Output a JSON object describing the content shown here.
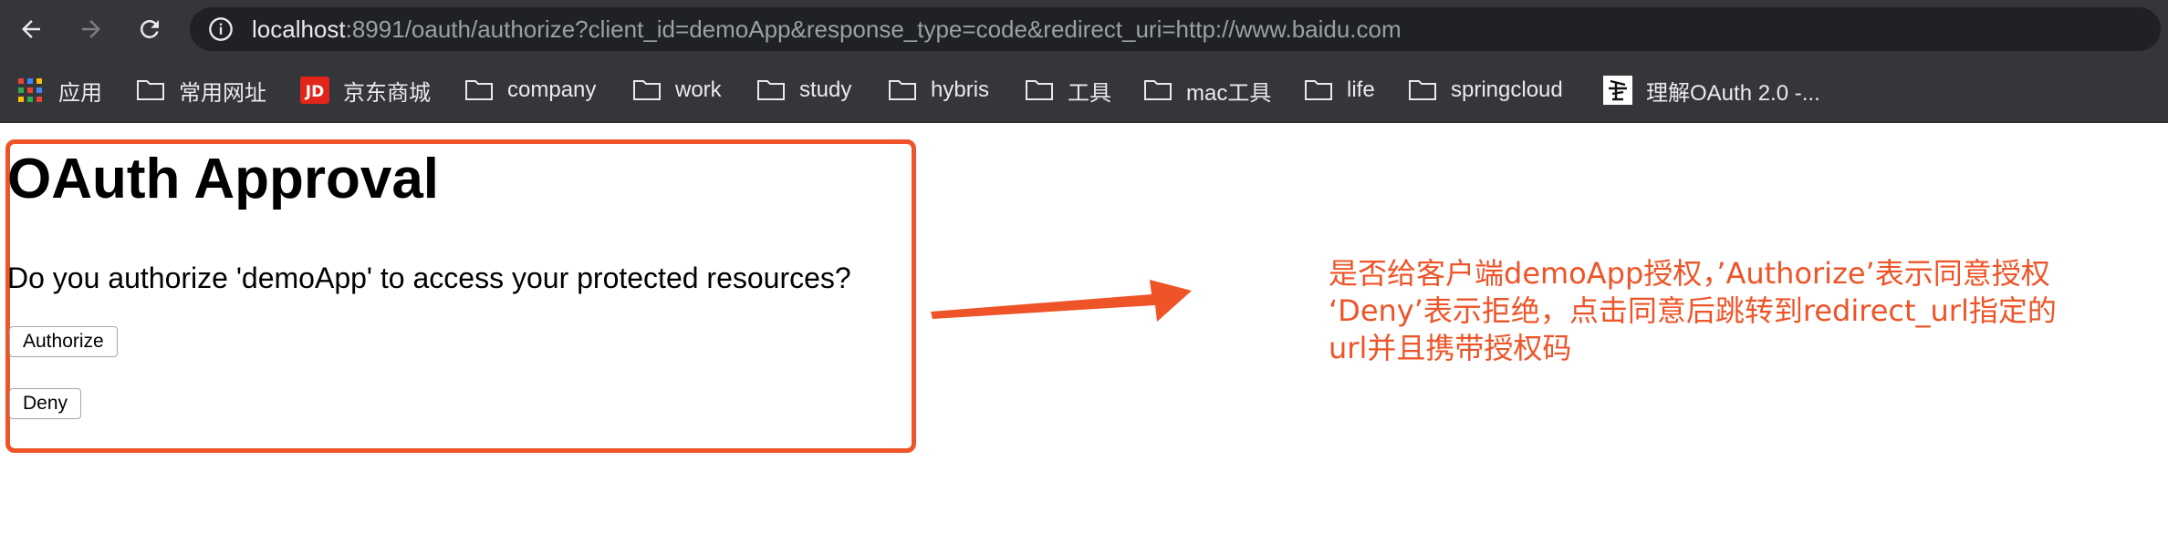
{
  "browser": {
    "url_host": "localhost",
    "url_rest": ":8991/oauth/authorize?client_id=demoApp&response_type=code&redirect_uri=http://www.baidu.com",
    "bookmarks": [
      {
        "label": "应用",
        "icon": "apps-grid-icon"
      },
      {
        "label": "常用网址",
        "icon": "folder-icon"
      },
      {
        "label": "京东商城",
        "icon": "jd-logo-icon"
      },
      {
        "label": "company",
        "icon": "folder-icon"
      },
      {
        "label": "work",
        "icon": "folder-icon"
      },
      {
        "label": "study",
        "icon": "folder-icon"
      },
      {
        "label": "hybris",
        "icon": "folder-icon"
      },
      {
        "label": "工具",
        "icon": "folder-icon"
      },
      {
        "label": "mac工具",
        "icon": "folder-icon"
      },
      {
        "label": "life",
        "icon": "folder-icon"
      },
      {
        "label": "springcloud",
        "icon": "folder-icon"
      },
      {
        "label": "理解OAuth 2.0 -...",
        "icon": "page-favicon-icon"
      }
    ]
  },
  "page": {
    "title": "OAuth Approval",
    "question": "Do you authorize 'demoApp' to access your protected resources?",
    "authorize_label": "Authorize",
    "deny_label": "Deny"
  },
  "annotation": {
    "line1": "是否给客户端demoApp授权，’Authorize’表示同意授权",
    "line2": "‘Deny’表示拒绝，点击同意后跳转到redirect_url指定的",
    "line3": "url并且携带授权码",
    "color": "#ee5428"
  }
}
